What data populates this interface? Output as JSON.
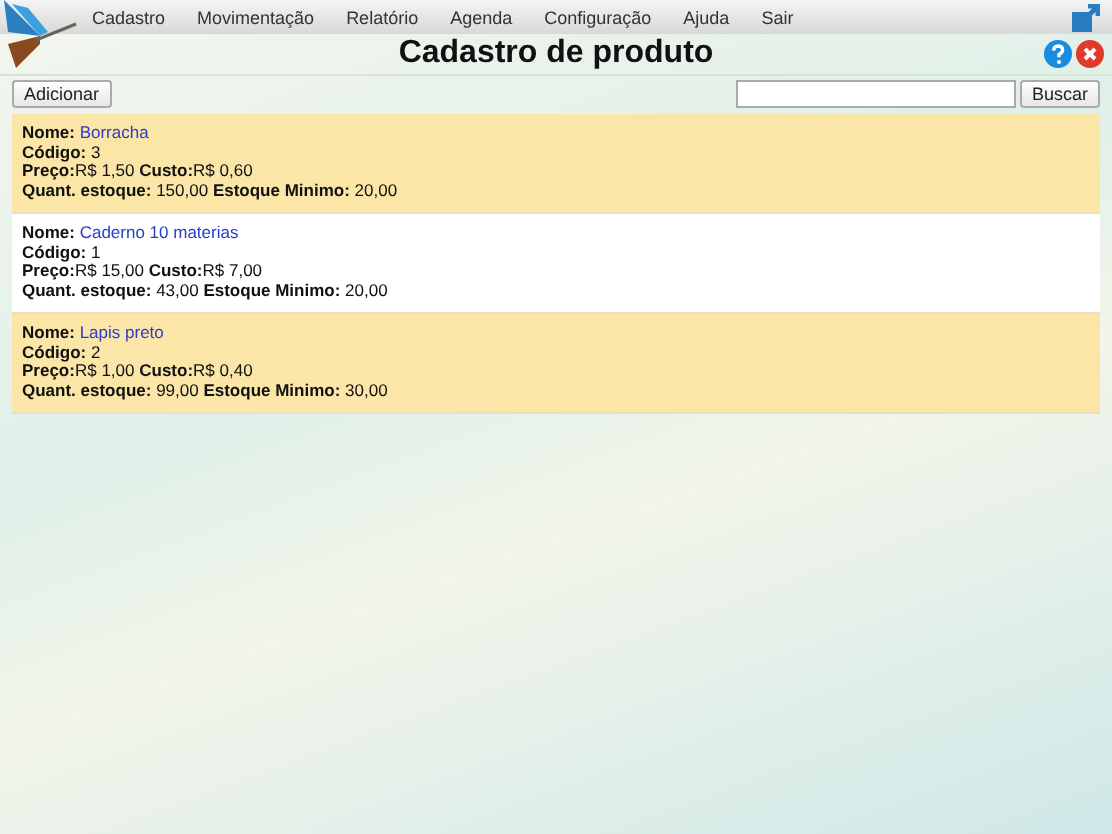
{
  "menu": [
    "Cadastro",
    "Movimentação",
    "Relatório",
    "Agenda",
    "Configuração",
    "Ajuda",
    "Sair"
  ],
  "title": "Cadastro de produto",
  "toolbar": {
    "add_button": "Adicionar",
    "search_button": "Buscar"
  },
  "products": [
    {
      "name_label": "Nome:",
      "name": "Borracha",
      "lines": [
        "**Código:** 3",
        "**Preço:**R$ 1,50 **Custo:**R$ 0,60",
        "**Quant. estoque:** 150,00 **Estoque Minimo:** 20,00"
      ]
    },
    {
      "name_label": "Nome:",
      "name": "Caderno 10 materias",
      "lines": [
        "**Código:** 1",
        "**Preço:**R$ 15,00 **Custo:**R$ 7,00",
        "**Quant. estoque:** 43,00 **Estoque Minimo:** 20,00"
      ]
    },
    {
      "name_label": "Nome:",
      "name": "Lapis preto",
      "lines": [
        "**Código:** 2",
        "**Preço:**R$ 1,00 **Custo:**R$ 0,40",
        "**Quant. estoque:** 99,00 **Estoque Minimo:** 30,00"
      ]
    }
  ]
}
